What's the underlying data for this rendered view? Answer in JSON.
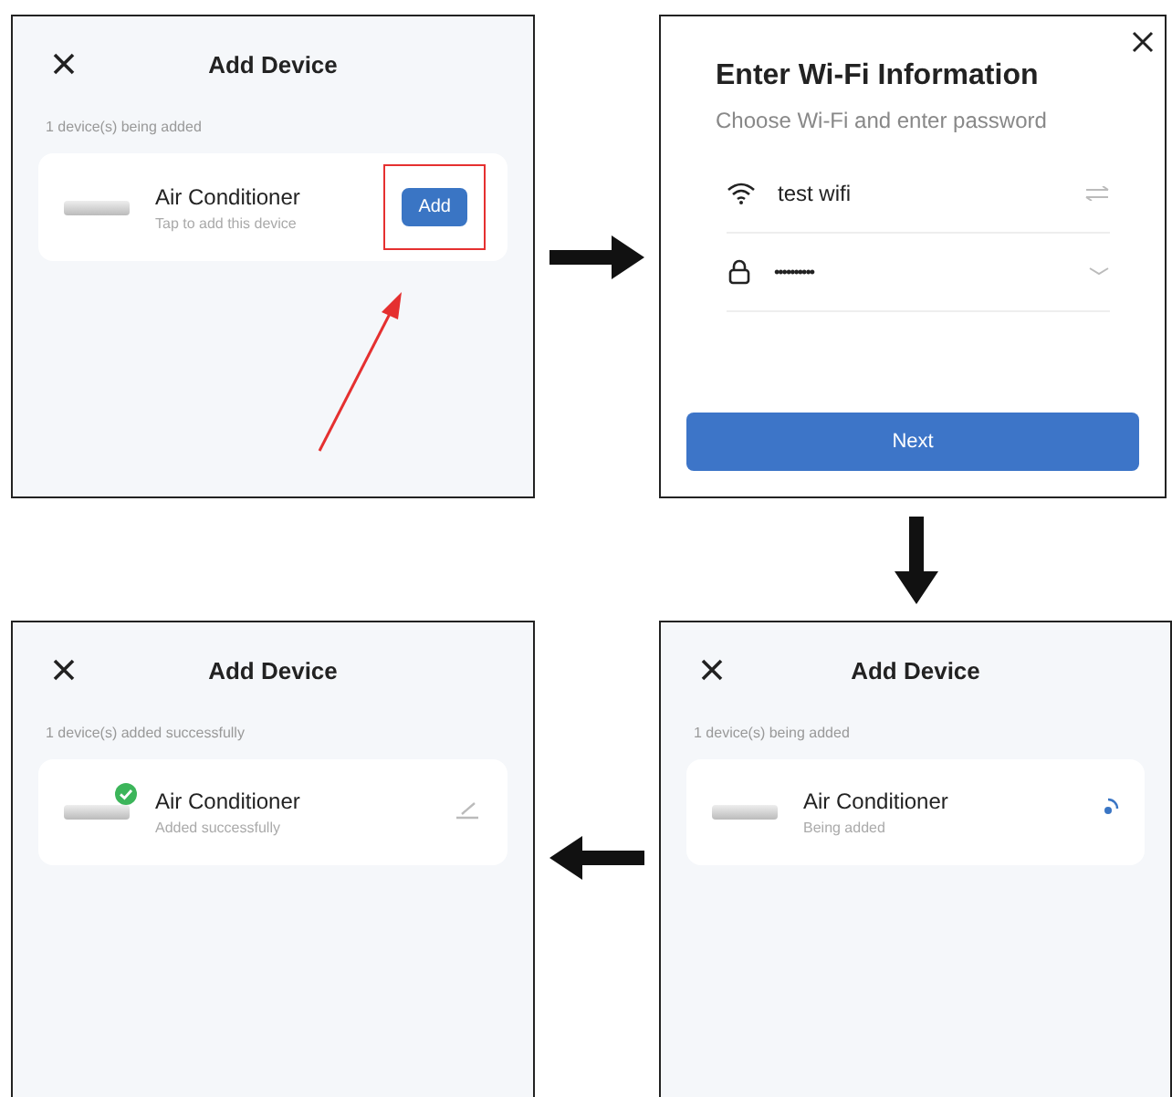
{
  "screens": [
    {
      "kind": "device_list",
      "title": "Add Device",
      "status": "1 device(s) being added",
      "device": {
        "name": "Air Conditioner",
        "subtitle": "Tap to add this device",
        "kind": "pending",
        "button": "Add"
      },
      "highlighted": true
    },
    {
      "kind": "wifi_form",
      "title": "Enter Wi-Fi Information",
      "subtitle": "Choose Wi-Fi and enter password",
      "fields": [
        {
          "kind": "network",
          "value": "test wifi"
        },
        {
          "kind": "password",
          "value": "••••••••••"
        }
      ],
      "button": "Next"
    },
    {
      "kind": "device_list",
      "title": "Add Device",
      "status": "1 device(s) added successfully",
      "device": {
        "name": "Air Conditioner",
        "subtitle": "Added successfully",
        "kind": "added"
      },
      "highlighted": false
    },
    {
      "kind": "device_list",
      "title": "Add Device",
      "status": "1 device(s) being added",
      "device": {
        "name": "Air Conditioner",
        "subtitle": "Being added",
        "kind": "loading"
      },
      "highlighted": false
    }
  ]
}
